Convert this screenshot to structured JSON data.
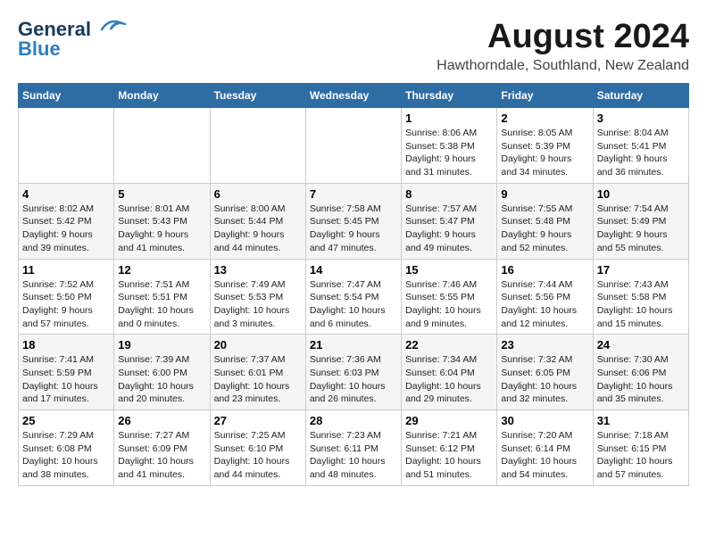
{
  "logo": {
    "line1": "General",
    "line2": "Blue"
  },
  "title": "August 2024",
  "subtitle": "Hawthorndale, Southland, New Zealand",
  "weekdays": [
    "Sunday",
    "Monday",
    "Tuesday",
    "Wednesday",
    "Thursday",
    "Friday",
    "Saturday"
  ],
  "weeks": [
    [
      {
        "day": "",
        "info": ""
      },
      {
        "day": "",
        "info": ""
      },
      {
        "day": "",
        "info": ""
      },
      {
        "day": "",
        "info": ""
      },
      {
        "day": "1",
        "info": "Sunrise: 8:06 AM\nSunset: 5:38 PM\nDaylight: 9 hours\nand 31 minutes."
      },
      {
        "day": "2",
        "info": "Sunrise: 8:05 AM\nSunset: 5:39 PM\nDaylight: 9 hours\nand 34 minutes."
      },
      {
        "day": "3",
        "info": "Sunrise: 8:04 AM\nSunset: 5:41 PM\nDaylight: 9 hours\nand 36 minutes."
      }
    ],
    [
      {
        "day": "4",
        "info": "Sunrise: 8:02 AM\nSunset: 5:42 PM\nDaylight: 9 hours\nand 39 minutes."
      },
      {
        "day": "5",
        "info": "Sunrise: 8:01 AM\nSunset: 5:43 PM\nDaylight: 9 hours\nand 41 minutes."
      },
      {
        "day": "6",
        "info": "Sunrise: 8:00 AM\nSunset: 5:44 PM\nDaylight: 9 hours\nand 44 minutes."
      },
      {
        "day": "7",
        "info": "Sunrise: 7:58 AM\nSunset: 5:45 PM\nDaylight: 9 hours\nand 47 minutes."
      },
      {
        "day": "8",
        "info": "Sunrise: 7:57 AM\nSunset: 5:47 PM\nDaylight: 9 hours\nand 49 minutes."
      },
      {
        "day": "9",
        "info": "Sunrise: 7:55 AM\nSunset: 5:48 PM\nDaylight: 9 hours\nand 52 minutes."
      },
      {
        "day": "10",
        "info": "Sunrise: 7:54 AM\nSunset: 5:49 PM\nDaylight: 9 hours\nand 55 minutes."
      }
    ],
    [
      {
        "day": "11",
        "info": "Sunrise: 7:52 AM\nSunset: 5:50 PM\nDaylight: 9 hours\nand 57 minutes."
      },
      {
        "day": "12",
        "info": "Sunrise: 7:51 AM\nSunset: 5:51 PM\nDaylight: 10 hours\nand 0 minutes."
      },
      {
        "day": "13",
        "info": "Sunrise: 7:49 AM\nSunset: 5:53 PM\nDaylight: 10 hours\nand 3 minutes."
      },
      {
        "day": "14",
        "info": "Sunrise: 7:47 AM\nSunset: 5:54 PM\nDaylight: 10 hours\nand 6 minutes."
      },
      {
        "day": "15",
        "info": "Sunrise: 7:46 AM\nSunset: 5:55 PM\nDaylight: 10 hours\nand 9 minutes."
      },
      {
        "day": "16",
        "info": "Sunrise: 7:44 AM\nSunset: 5:56 PM\nDaylight: 10 hours\nand 12 minutes."
      },
      {
        "day": "17",
        "info": "Sunrise: 7:43 AM\nSunset: 5:58 PM\nDaylight: 10 hours\nand 15 minutes."
      }
    ],
    [
      {
        "day": "18",
        "info": "Sunrise: 7:41 AM\nSunset: 5:59 PM\nDaylight: 10 hours\nand 17 minutes."
      },
      {
        "day": "19",
        "info": "Sunrise: 7:39 AM\nSunset: 6:00 PM\nDaylight: 10 hours\nand 20 minutes."
      },
      {
        "day": "20",
        "info": "Sunrise: 7:37 AM\nSunset: 6:01 PM\nDaylight: 10 hours\nand 23 minutes."
      },
      {
        "day": "21",
        "info": "Sunrise: 7:36 AM\nSunset: 6:03 PM\nDaylight: 10 hours\nand 26 minutes."
      },
      {
        "day": "22",
        "info": "Sunrise: 7:34 AM\nSunset: 6:04 PM\nDaylight: 10 hours\nand 29 minutes."
      },
      {
        "day": "23",
        "info": "Sunrise: 7:32 AM\nSunset: 6:05 PM\nDaylight: 10 hours\nand 32 minutes."
      },
      {
        "day": "24",
        "info": "Sunrise: 7:30 AM\nSunset: 6:06 PM\nDaylight: 10 hours\nand 35 minutes."
      }
    ],
    [
      {
        "day": "25",
        "info": "Sunrise: 7:29 AM\nSunset: 6:08 PM\nDaylight: 10 hours\nand 38 minutes."
      },
      {
        "day": "26",
        "info": "Sunrise: 7:27 AM\nSunset: 6:09 PM\nDaylight: 10 hours\nand 41 minutes."
      },
      {
        "day": "27",
        "info": "Sunrise: 7:25 AM\nSunset: 6:10 PM\nDaylight: 10 hours\nand 44 minutes."
      },
      {
        "day": "28",
        "info": "Sunrise: 7:23 AM\nSunset: 6:11 PM\nDaylight: 10 hours\nand 48 minutes."
      },
      {
        "day": "29",
        "info": "Sunrise: 7:21 AM\nSunset: 6:12 PM\nDaylight: 10 hours\nand 51 minutes."
      },
      {
        "day": "30",
        "info": "Sunrise: 7:20 AM\nSunset: 6:14 PM\nDaylight: 10 hours\nand 54 minutes."
      },
      {
        "day": "31",
        "info": "Sunrise: 7:18 AM\nSunset: 6:15 PM\nDaylight: 10 hours\nand 57 minutes."
      }
    ]
  ]
}
